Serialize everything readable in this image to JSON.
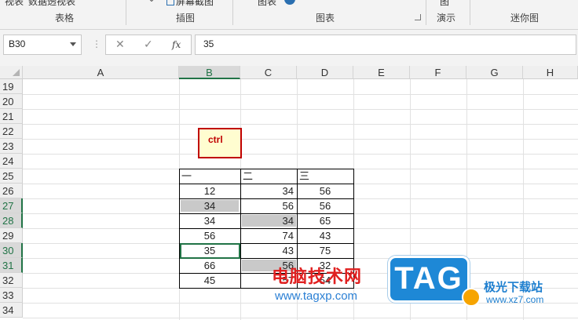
{
  "ribbon": {
    "top_items": [
      "视表",
      "数据透视表",
      "屏幕截图",
      "图表"
    ],
    "groups": [
      "表格",
      "插图",
      "图表",
      "演示",
      "迷你图"
    ],
    "demo_top": "图"
  },
  "formula_bar": {
    "name_box": "B30",
    "dots": "⋮",
    "cancel": "✕",
    "enter": "✓",
    "fx": "fx",
    "value": "35"
  },
  "columns": [
    "A",
    "B",
    "C",
    "D",
    "E",
    "F",
    "G",
    "H"
  ],
  "rows": [
    "19",
    "20",
    "21",
    "22",
    "23",
    "24",
    "25",
    "26",
    "27",
    "28",
    "29",
    "30",
    "31",
    "32",
    "33",
    "34"
  ],
  "shape_label": "ctrl",
  "table": {
    "headers": [
      "一",
      "二",
      "三"
    ],
    "b": [
      "12",
      "34",
      "34",
      "56",
      "35",
      "66",
      "45"
    ],
    "c": [
      "34",
      "56",
      "34",
      "74",
      "43",
      "56",
      "57"
    ],
    "d": [
      "56",
      "56",
      "65",
      "43",
      "75",
      "32",
      "54"
    ]
  },
  "watermark": {
    "cn": "电脑技术网",
    "url": "www.tagxp.com",
    "logo": "TAG",
    "site": "极光下载站",
    "site_url": "www.xz7.com"
  },
  "colors": {
    "accent": "#217346",
    "shape_border": "#c00000",
    "shape_fill": "#fffdd0",
    "highlight": "#c9c9c9"
  }
}
